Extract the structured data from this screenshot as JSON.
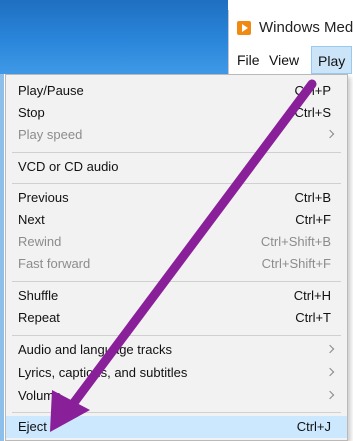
{
  "window": {
    "title": "Windows Med"
  },
  "menubar": {
    "file": "File",
    "view": "View",
    "play": "Play"
  },
  "menu": {
    "play_pause": "Play/Pause",
    "play_pause_sc": "Ctrl+P",
    "stop": "Stop",
    "stop_sc": "Ctrl+S",
    "play_speed": "Play speed",
    "vcd": "VCD or CD audio",
    "previous": "Previous",
    "previous_sc": "Ctrl+B",
    "next": "Next",
    "next_sc": "Ctrl+F",
    "rewind": "Rewind",
    "rewind_sc": "Ctrl+Shift+B",
    "fast_forward": "Fast forward",
    "fast_forward_sc": "Ctrl+Shift+F",
    "shuffle": "Shuffle",
    "shuffle_sc": "Ctrl+H",
    "repeat": "Repeat",
    "repeat_sc": "Ctrl+T",
    "audio_tracks": "Audio and language tracks",
    "lyrics": "Lyrics, captions, and subtitles",
    "volume": "Volume",
    "eject": "Eject",
    "eject_sc": "Ctrl+J"
  },
  "colors": {
    "annotation_arrow": "#8a1f9a",
    "highlight": "#cce8ff"
  },
  "icons": {
    "app": "media-player-icon",
    "submenu": "chevron-right-icon"
  }
}
